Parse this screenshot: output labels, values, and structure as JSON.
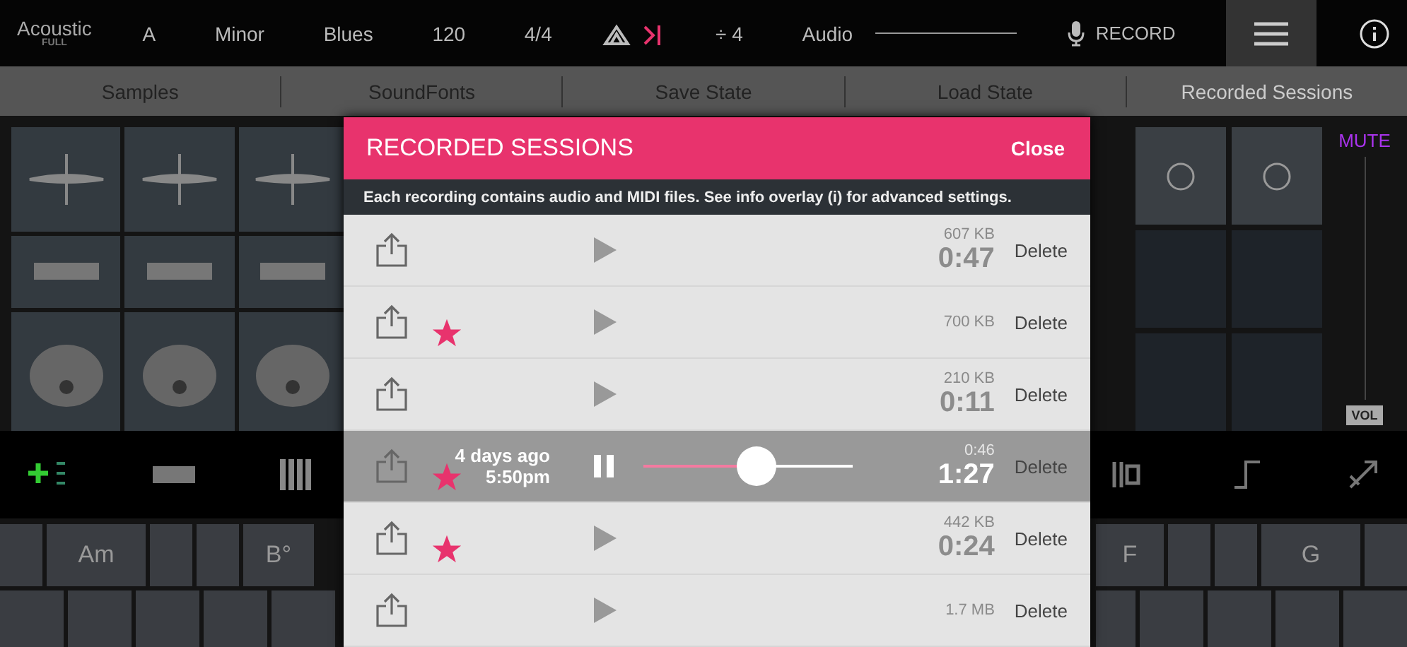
{
  "top_bar": [
    {
      "kind": "logo",
      "text": "Acoustic",
      "sub": "FULL"
    },
    {
      "kind": "text",
      "text": "A"
    },
    {
      "kind": "text",
      "text": "Minor"
    },
    {
      "kind": "text",
      "text": "Blues"
    },
    {
      "kind": "text",
      "text": "120"
    },
    {
      "kind": "text",
      "text": "4/4"
    },
    {
      "kind": "chords"
    },
    {
      "kind": "text",
      "text": "÷ 4"
    },
    {
      "kind": "audio",
      "text": "Audio"
    },
    {
      "kind": "record",
      "text": "RECORD"
    },
    {
      "kind": "menu",
      "selected": true
    },
    {
      "kind": "info"
    }
  ],
  "tabs": [
    {
      "label": "Samples",
      "selected": false
    },
    {
      "label": "SoundFonts",
      "selected": false
    },
    {
      "label": "Save State",
      "selected": false
    },
    {
      "label": "Load State",
      "selected": false
    },
    {
      "label": "Recorded Sessions",
      "selected": true
    }
  ],
  "mixer": {
    "mute": "MUTE",
    "vol": "VOL"
  },
  "keys": [
    {
      "label": "Am"
    },
    {
      "label": "B°"
    },
    {
      "label": "F"
    },
    {
      "label": "G"
    }
  ],
  "modal": {
    "title": "RECORDED SESSIONS",
    "close": "Close",
    "note": "Each recording contains audio and MIDI files. See info overlay (i) for advanced settings.",
    "rows": [
      {
        "selected": false,
        "starred": false,
        "playing": false,
        "size": "607 KB",
        "duration": "0:47",
        "delete": "Delete"
      },
      {
        "selected": false,
        "starred": true,
        "playing": false,
        "size": "700 KB",
        "delete": "Delete"
      },
      {
        "selected": false,
        "starred": false,
        "playing": false,
        "size": "210 KB",
        "duration": "0:11",
        "delete": "Delete"
      },
      {
        "selected": true,
        "starred": true,
        "playing": true,
        "date": "4 days ago",
        "time": "5:50pm",
        "level": 0.54,
        "size": "0:46",
        "duration": "1:27",
        "delete": "Delete"
      },
      {
        "selected": false,
        "starred": true,
        "playing": false,
        "size": "442 KB",
        "duration": "0:24",
        "delete": "Delete"
      },
      {
        "selected": false,
        "starred": false,
        "playing": false,
        "size": "1.7 MB",
        "delete": "Delete"
      }
    ]
  }
}
